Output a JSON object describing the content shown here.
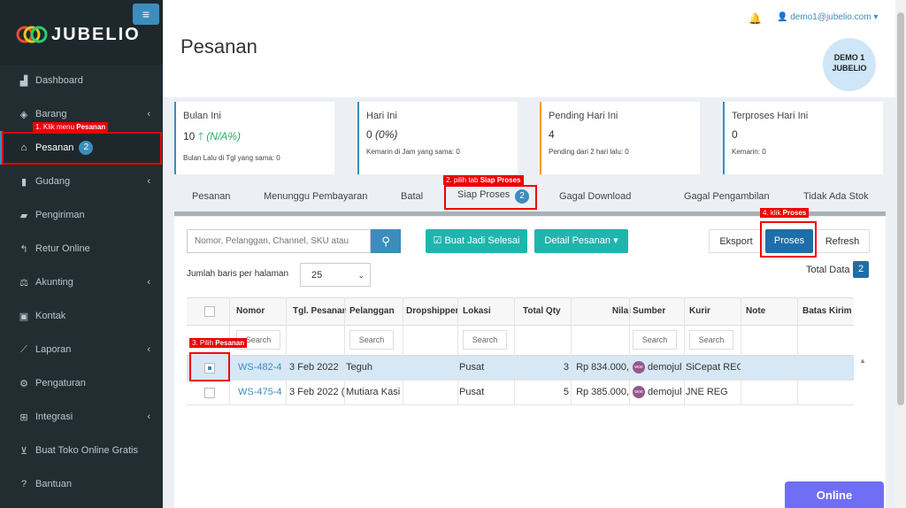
{
  "brand": {
    "name": "JUBELIO"
  },
  "sidebar": {
    "items": [
      {
        "label": "Dashboard",
        "icon": "chart-area-icon"
      },
      {
        "label": "Barang",
        "icon": "cubes-icon"
      },
      {
        "label": "Pesanan",
        "icon": "basket-icon",
        "badge": "2"
      },
      {
        "label": "Gudang",
        "icon": "building-icon"
      },
      {
        "label": "Pengiriman",
        "icon": "truck-icon"
      },
      {
        "label": "Retur Online",
        "icon": "reply-icon"
      },
      {
        "label": "Akunting",
        "icon": "balance-scale-icon"
      },
      {
        "label": "Kontak",
        "icon": "address-card-icon"
      },
      {
        "label": "Laporan",
        "icon": "line-chart-icon"
      },
      {
        "label": "Pengaturan",
        "icon": "cogs-icon"
      },
      {
        "label": "Integrasi",
        "icon": "sitemap-icon"
      },
      {
        "label": "Buat Toko Online Gratis",
        "icon": "cart-icon"
      },
      {
        "label": "Bantuan",
        "icon": "question-circle-icon"
      }
    ],
    "annotation": {
      "prefix": "1. Klik menu ",
      "bold": "Pesanan"
    }
  },
  "header": {
    "title": "Pesanan",
    "user_email": "demo1@jubelio.com",
    "avatar_line1": "DEMO 1",
    "avatar_line2": "JUBELIO"
  },
  "stats": [
    {
      "label": "Bulan Ini",
      "value": "10",
      "change": "(N/A%)",
      "sub": "Bulan Lalu di Tgl yang sama: 0",
      "color": "#3c8dbc"
    },
    {
      "label": "Hari Ini",
      "value": "0",
      "change": "(0%)",
      "sub": "Kemarin di Jam yang sama: 0",
      "color": "#3c8dbc"
    },
    {
      "label": "Pending Hari Ini",
      "value": "4",
      "change": "",
      "sub": "Pending dari 2 hari lalu: 0",
      "color": "#f39c12"
    },
    {
      "label": "Terproses Hari Ini",
      "value": "0",
      "change": "",
      "sub": "Kemarin: 0",
      "color": "#3c8dbc"
    }
  ],
  "tabs": [
    {
      "label": "Pesanan"
    },
    {
      "label": "Menunggu Pembayaran"
    },
    {
      "label": "Batal"
    },
    {
      "label": "Siap Proses",
      "badge": "2"
    },
    {
      "label": "Gagal Download"
    },
    {
      "label": "Gagal Pengambilan"
    },
    {
      "label": "Tidak Ada Stok"
    }
  ],
  "tab_annotation": {
    "prefix": "2. pilih tab ",
    "bold": "Siap Proses"
  },
  "toolbar": {
    "search_placeholder": "Nomor, Pelanggan, Channel, SKU atau",
    "buat_jadi_selesai": "Buat Jadi Selesai",
    "detail_pesanan": "Detail Pesanan",
    "eksport": "Eksport",
    "proses": "Proses",
    "refresh": "Refresh",
    "proses_annotation": {
      "prefix": "4. klik ",
      "bold": "Proses"
    },
    "rows_label": "Jumlah baris per halaman",
    "rows_value": "25",
    "total_label": "Total Data",
    "total_value": "2"
  },
  "table": {
    "columns": [
      "Nomor",
      "Tgl. Pesanan",
      "Pelanggan",
      "Dropshipper",
      "Lokasi",
      "Total Qty",
      "Nilai",
      "Sumber",
      "Kurir",
      "Note",
      "Batas Kirim"
    ],
    "filter_placeholder": "Search",
    "rows": [
      {
        "nomor": "WS-482-4",
        "tgl": "3 Feb 2022",
        "pelanggan": "Teguh",
        "dropshipper": "",
        "lokasi": "Pusat",
        "qty": "3",
        "nilai": "Rp 834.000,",
        "sumber": "demojul",
        "kurir": "SiCepat REG",
        "selected": true
      },
      {
        "nomor": "WS-475-4",
        "tgl": "3 Feb 2022 (",
        "pelanggan": "Mutiara Kasi",
        "dropshipper": "",
        "lokasi": "Pusat",
        "qty": "5",
        "nilai": "Rp 385.000,",
        "sumber": "demojul",
        "kurir": "JNE REG",
        "selected": false
      }
    ],
    "row_annotation": {
      "prefix": "3. Pilih ",
      "bold": "Pesanan"
    }
  },
  "chat": {
    "label": "Online"
  }
}
